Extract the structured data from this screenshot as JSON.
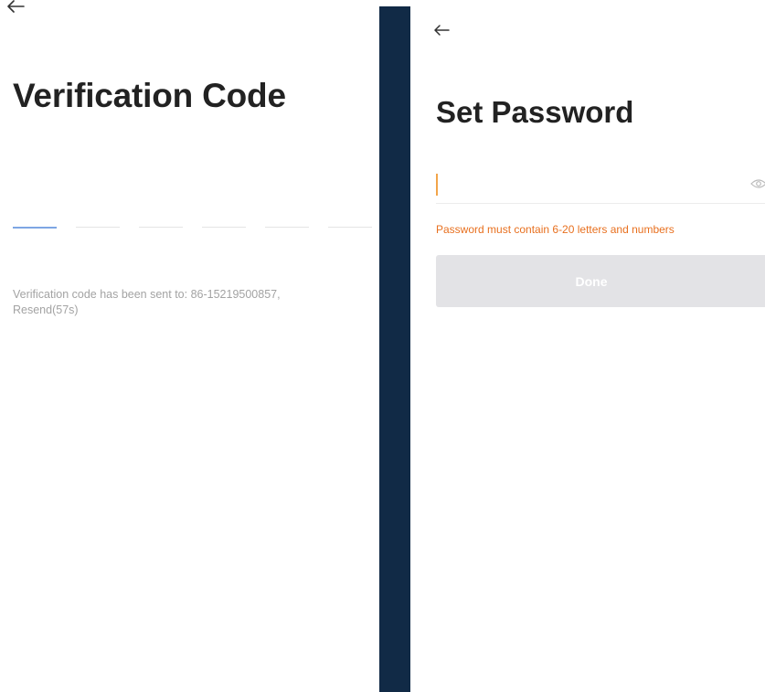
{
  "verification_screen": {
    "back_icon": "arrow-left-icon",
    "title": "Verification Code",
    "code_slot_count": 6,
    "active_slot": 1,
    "sent_message": "Verification code has been sent to: 86-15219500857,",
    "resend_label": "Resend(57s)"
  },
  "password_screen": {
    "back_icon": "arrow-left-icon",
    "title": "Set Password",
    "password_value": "",
    "eye_icon": "eye-toggle-icon",
    "hint": "Password must contain 6-20 letters and numbers",
    "done_label": "Done"
  },
  "colors": {
    "divider": "#112a46",
    "hint": "#e8701f",
    "caret": "#f2a54a",
    "active_slot": "#7ea6e3",
    "button_disabled": "#e3e3e6"
  }
}
